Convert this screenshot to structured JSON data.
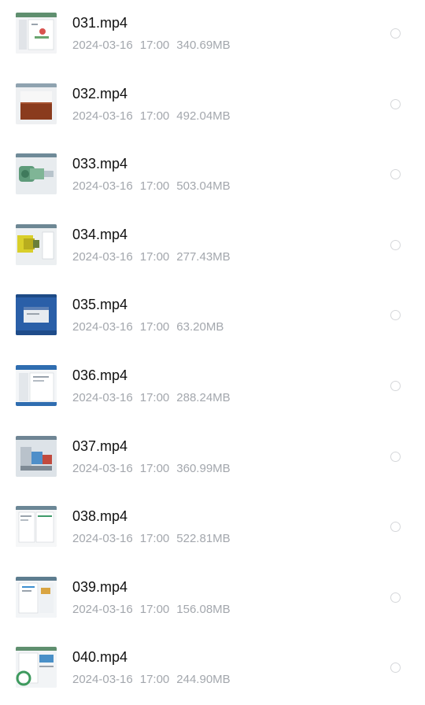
{
  "files": [
    {
      "name": "031.mp4",
      "date": "2024-03-16",
      "time": "17:00",
      "size": "340.69MB",
      "thumbnail_icon": "video-thumbnail-icon"
    },
    {
      "name": "032.mp4",
      "date": "2024-03-16",
      "time": "17:00",
      "size": "492.04MB",
      "thumbnail_icon": "video-thumbnail-icon"
    },
    {
      "name": "033.mp4",
      "date": "2024-03-16",
      "time": "17:00",
      "size": "503.04MB",
      "thumbnail_icon": "video-thumbnail-icon"
    },
    {
      "name": "034.mp4",
      "date": "2024-03-16",
      "time": "17:00",
      "size": "277.43MB",
      "thumbnail_icon": "video-thumbnail-icon"
    },
    {
      "name": "035.mp4",
      "date": "2024-03-16",
      "time": "17:00",
      "size": "63.20MB",
      "thumbnail_icon": "video-thumbnail-icon"
    },
    {
      "name": "036.mp4",
      "date": "2024-03-16",
      "time": "17:00",
      "size": "288.24MB",
      "thumbnail_icon": "video-thumbnail-icon"
    },
    {
      "name": "037.mp4",
      "date": "2024-03-16",
      "time": "17:00",
      "size": "360.99MB",
      "thumbnail_icon": "video-thumbnail-icon"
    },
    {
      "name": "038.mp4",
      "date": "2024-03-16",
      "time": "17:00",
      "size": "522.81MB",
      "thumbnail_icon": "video-thumbnail-icon"
    },
    {
      "name": "039.mp4",
      "date": "2024-03-16",
      "time": "17:00",
      "size": "156.08MB",
      "thumbnail_icon": "video-thumbnail-icon"
    },
    {
      "name": "040.mp4",
      "date": "2024-03-16",
      "time": "17:00",
      "size": "244.90MB",
      "thumbnail_icon": "video-thumbnail-icon"
    }
  ],
  "colors": {
    "name_text": "#111111",
    "meta_text": "#a3a7ad",
    "radio_border": "#d5d7da",
    "background": "#ffffff"
  }
}
